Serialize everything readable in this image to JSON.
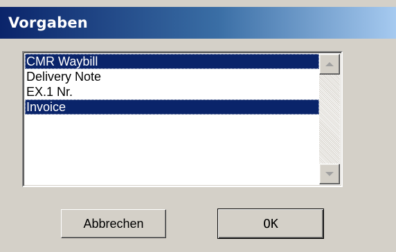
{
  "window": {
    "title": "Vorgaben"
  },
  "list": {
    "items": [
      {
        "label": "CMR Waybill",
        "selected": true
      },
      {
        "label": "Delivery Note",
        "selected": false
      },
      {
        "label": "EX.1 Nr.",
        "selected": false
      },
      {
        "label": "Invoice",
        "selected": true
      }
    ]
  },
  "buttons": {
    "cancel_label": "Abbrechen",
    "ok_label": "OK"
  },
  "colors": {
    "selection_background": "#0a246a",
    "titlebar_start": "#0a246a",
    "titlebar_end": "#a6caf0",
    "dialog_background": "#d4d0c8"
  },
  "icons": {
    "scroll_up": "triangle-up",
    "scroll_down": "triangle-down"
  }
}
